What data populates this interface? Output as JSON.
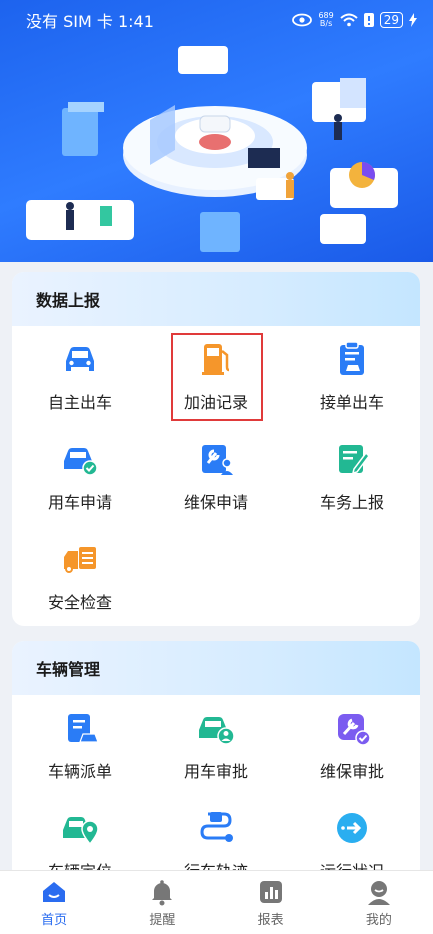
{
  "status_bar": {
    "carrier_time": "没有 SIM 卡 1:41",
    "net_speed_top": "689",
    "net_speed_bottom": "B/s",
    "battery": "29"
  },
  "sections": [
    {
      "title": "数据上报",
      "items": [
        {
          "label": "自主出车",
          "icon": "car-icon",
          "color": "#2a7cf6"
        },
        {
          "label": "加油记录",
          "icon": "fuel-pump-icon",
          "color": "#f5962b"
        },
        {
          "label": "接单出车",
          "icon": "clipboard-car-icon",
          "color": "#2a7cf6"
        },
        {
          "label": "用车申请",
          "icon": "car-check-icon",
          "color": "#2a7cf6"
        },
        {
          "label": "维保申请",
          "icon": "wrench-person-icon",
          "color": "#2a7cf6"
        },
        {
          "label": "车务上报",
          "icon": "edit-doc-icon",
          "color": "#22b893"
        },
        {
          "label": "安全检查",
          "icon": "truck-checklist-icon",
          "color": "#f5962b"
        }
      ]
    },
    {
      "title": "车辆管理",
      "items": [
        {
          "label": "车辆派单",
          "icon": "clipboard-car-icon",
          "color": "#2a7cf6"
        },
        {
          "label": "用车审批",
          "icon": "car-person-icon",
          "color": "#22b893"
        },
        {
          "label": "维保审批",
          "icon": "wrench-check-icon",
          "color": "#7b5cf0"
        },
        {
          "label": "车辆定位",
          "icon": "car-location-icon",
          "color": "#22b893"
        },
        {
          "label": "行车轨迹",
          "icon": "route-icon",
          "color": "#2a7cf6"
        },
        {
          "label": "运行状况",
          "icon": "status-arrow-icon",
          "color": "#2aaef0"
        }
      ]
    }
  ],
  "tabs": [
    {
      "label": "首页",
      "icon": "home-icon",
      "active": true
    },
    {
      "label": "提醒",
      "icon": "bell-icon",
      "active": false
    },
    {
      "label": "报表",
      "icon": "chart-icon",
      "active": false
    },
    {
      "label": "我的",
      "icon": "profile-icon",
      "active": false
    }
  ],
  "colors": {
    "accent": "#2a6cf0",
    "highlight_border": "#e03a3a",
    "hero_blue": "#2f7cff"
  }
}
